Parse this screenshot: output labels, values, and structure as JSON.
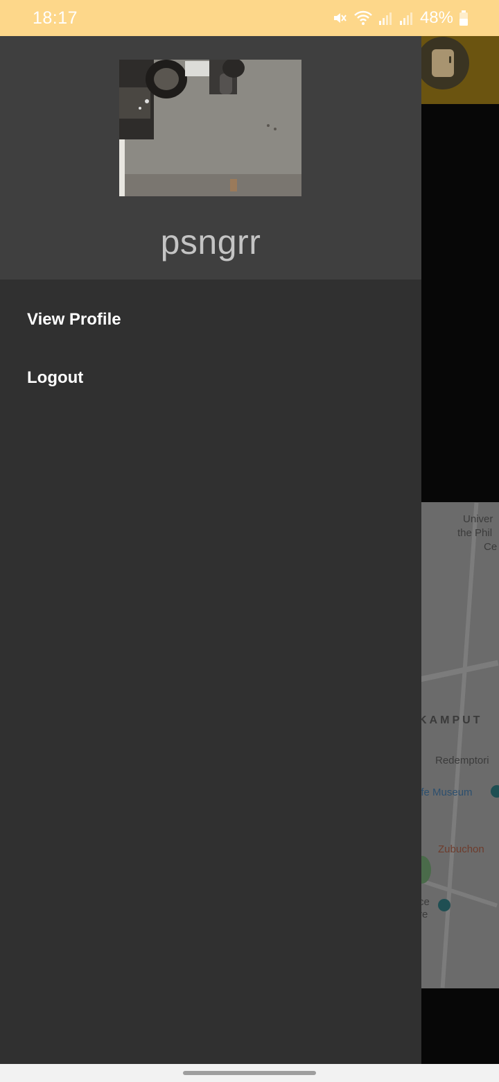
{
  "status_bar": {
    "time": "18:17",
    "battery": "48%",
    "icons": [
      "mute-icon",
      "wifi-icon",
      "signal-icon",
      "signal-icon",
      "battery-icon"
    ],
    "background_color": "#fdd78a"
  },
  "drawer": {
    "username": "psngrr",
    "profile_image_alt": "profile-photo",
    "menu": [
      {
        "label": "View Profile"
      },
      {
        "label": "Logout"
      }
    ],
    "colors": {
      "header": "#3f3f3f",
      "body": "#303030"
    }
  },
  "background_map": {
    "labels": [
      "Univer",
      "the Phil",
      "Ce",
      "KAMPUT",
      "Redemptori",
      "ife Museum",
      "Zubuchon",
      "ce",
      "re"
    ]
  },
  "theme": {
    "accent": "#fdd78a"
  }
}
